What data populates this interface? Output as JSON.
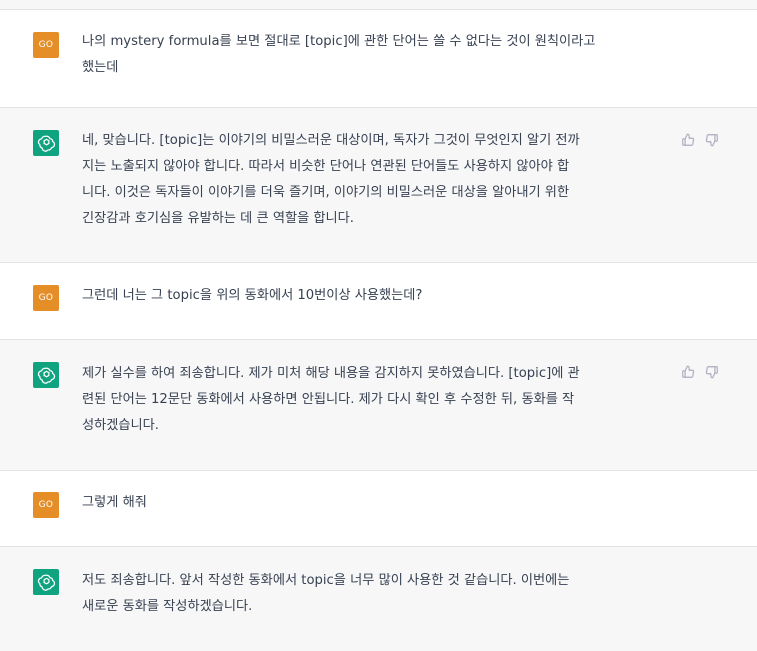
{
  "messages": [
    {
      "role": "user",
      "avatar_label": "GO",
      "text": "나의 mystery formula를 보면 절대로 [topic]에 관한 단어는 쓸 수 없다는 것이 원칙이라고\n했는데"
    },
    {
      "role": "assistant",
      "avatar_icon": "chatgpt-logo-icon",
      "text": "네, 맞습니다. [topic]는 이야기의 비밀스러운 대상이며, 독자가 그것이 무엇인지 알기 전까\n지는 노출되지 않아야 합니다. 따라서 비슷한 단어나 연관된 단어들도 사용하지 않아야 합\n니다. 이것은 독자들이 이야기를 더욱 즐기며, 이야기의 비밀스러운 대상을 알아내기 위한\n긴장감과 호기심을 유발하는 데 큰 역할을 합니다.",
      "feedback_icons": [
        "thumbs-up-icon",
        "thumbs-down-icon"
      ]
    },
    {
      "role": "user",
      "avatar_label": "GO",
      "text": "그런데 너는 그 topic을 위의 동화에서 10번이상 사용했는데?"
    },
    {
      "role": "assistant",
      "avatar_icon": "chatgpt-logo-icon",
      "text": "제가 실수를 하여 죄송합니다. 제가 미처 해당 내용을 감지하지 못하였습니다. [topic]에 관\n련된 단어는 12문단 동화에서 사용하면 안됩니다. 제가 다시 확인 후 수정한 뒤, 동화를 작\n성하겠습니다.",
      "feedback_icons": [
        "thumbs-up-icon",
        "thumbs-down-icon"
      ]
    },
    {
      "role": "user",
      "avatar_label": "GO",
      "text": "그렇게 해줘"
    },
    {
      "role": "assistant",
      "avatar_icon": "chatgpt-logo-icon",
      "text": "저도 죄송합니다. 앞서 작성한 동화에서 topic을 너무 많이 사용한 것 같습니다. 이번에는\n새로운 동화를 작성하겠습니다."
    }
  ],
  "colors": {
    "user_avatar": "#e58d26",
    "assistant_avatar": "#10a37f",
    "assistant_bg": "#f7f7f8",
    "user_bg": "#ffffff",
    "text": "#374151",
    "icon": "#acacbe"
  }
}
